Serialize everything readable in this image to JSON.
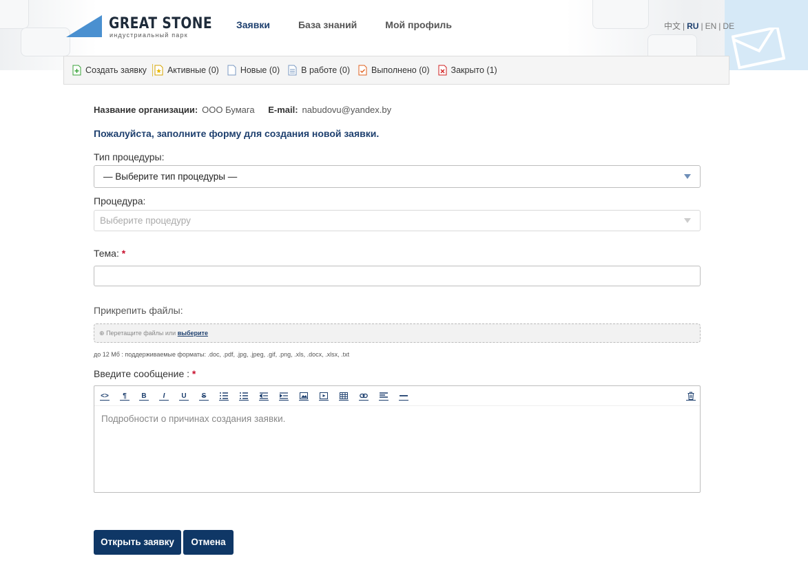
{
  "header": {
    "logo_name": "GREAT STONE",
    "logo_sub": "индустриальный парк",
    "nav": [
      {
        "label": "Заявки",
        "active": true
      },
      {
        "label": "База знаний",
        "active": false
      },
      {
        "label": "Мой профиль",
        "active": false
      }
    ],
    "langs": [
      "中文",
      "RU",
      "EN",
      "DE"
    ],
    "current_lang": "RU"
  },
  "toolbar": {
    "create": "Создать заявку",
    "active": "Активные (0)",
    "new": "Новые (0)",
    "in_work": "В работе (0)",
    "done": "Выполнено (0)",
    "closed": "Закрыто (1)"
  },
  "info": {
    "org_label": "Название организации:",
    "org_value": "ООО Бумага",
    "email_label": "E-mail:",
    "email_value": "nabudovu@yandex.by"
  },
  "form": {
    "intro": "Пожалуйста, заполните форму для создания новой заявки.",
    "type_label": "Тип процедуры:",
    "type_value": "— Выберите тип процедуры —",
    "proc_label": "Процедура:",
    "proc_placeholder": "Выберите процедуру",
    "subject_label": "Тема:",
    "subject_value": "",
    "attach_label": "Прикрепить файлы:",
    "drop_text": "Перетащите файлы или",
    "drop_link": "выберите",
    "hint": "до 12 Мб : поддерживаемые форматы: .doc, .pdf, .jpg, .jpeg, .gif, .png, .xls, .docx, .xlsx, .txt",
    "message_label": "Введите сообщение :",
    "message_placeholder": "Подробности о причинах создания заявки.",
    "required_mark": "*"
  },
  "buttons": {
    "submit": "Открыть заявку",
    "cancel": "Отмена"
  },
  "colors": {
    "primary": "#0f3766",
    "accent_text": "#1d3f6e",
    "required": "#c8102e"
  }
}
